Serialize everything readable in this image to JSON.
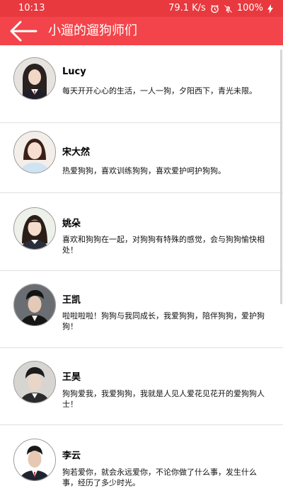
{
  "status": {
    "time": "10:13",
    "speed": "79.1 K/s",
    "battery": "100%"
  },
  "app": {
    "title": "小遛的遛狗师们",
    "back_icon": "arrow-left-icon"
  },
  "colors": {
    "accent": "#f2444a",
    "status_bar": "#e8393f"
  },
  "trainers": [
    {
      "name": "Lucy",
      "desc": "每天开开心心的生活，一人一狗，夕阳西下，青光未限。"
    },
    {
      "name": "宋大然",
      "desc": "热爱狗狗，喜欢训练狗狗，喜欢爱护呵护狗狗。"
    },
    {
      "name": "姚朵",
      "desc": "喜欢和狗狗在一起，对狗狗有特殊的感觉，会与狗狗愉快相处！"
    },
    {
      "name": "王凯",
      "desc": "啦啦啦啦！狗狗与我同成长，我爱狗狗，陪伴狗狗，爱护狗狗！"
    },
    {
      "name": "王昊",
      "desc": "狗狗爱我，我爱狗狗，我就是人见人爱花见花开的爱狗狗人士！"
    },
    {
      "name": "李云",
      "desc": "狗若爱你，就会永远爱你，不论你做了什么事，发生什么事，经历了多少时光。"
    }
  ]
}
